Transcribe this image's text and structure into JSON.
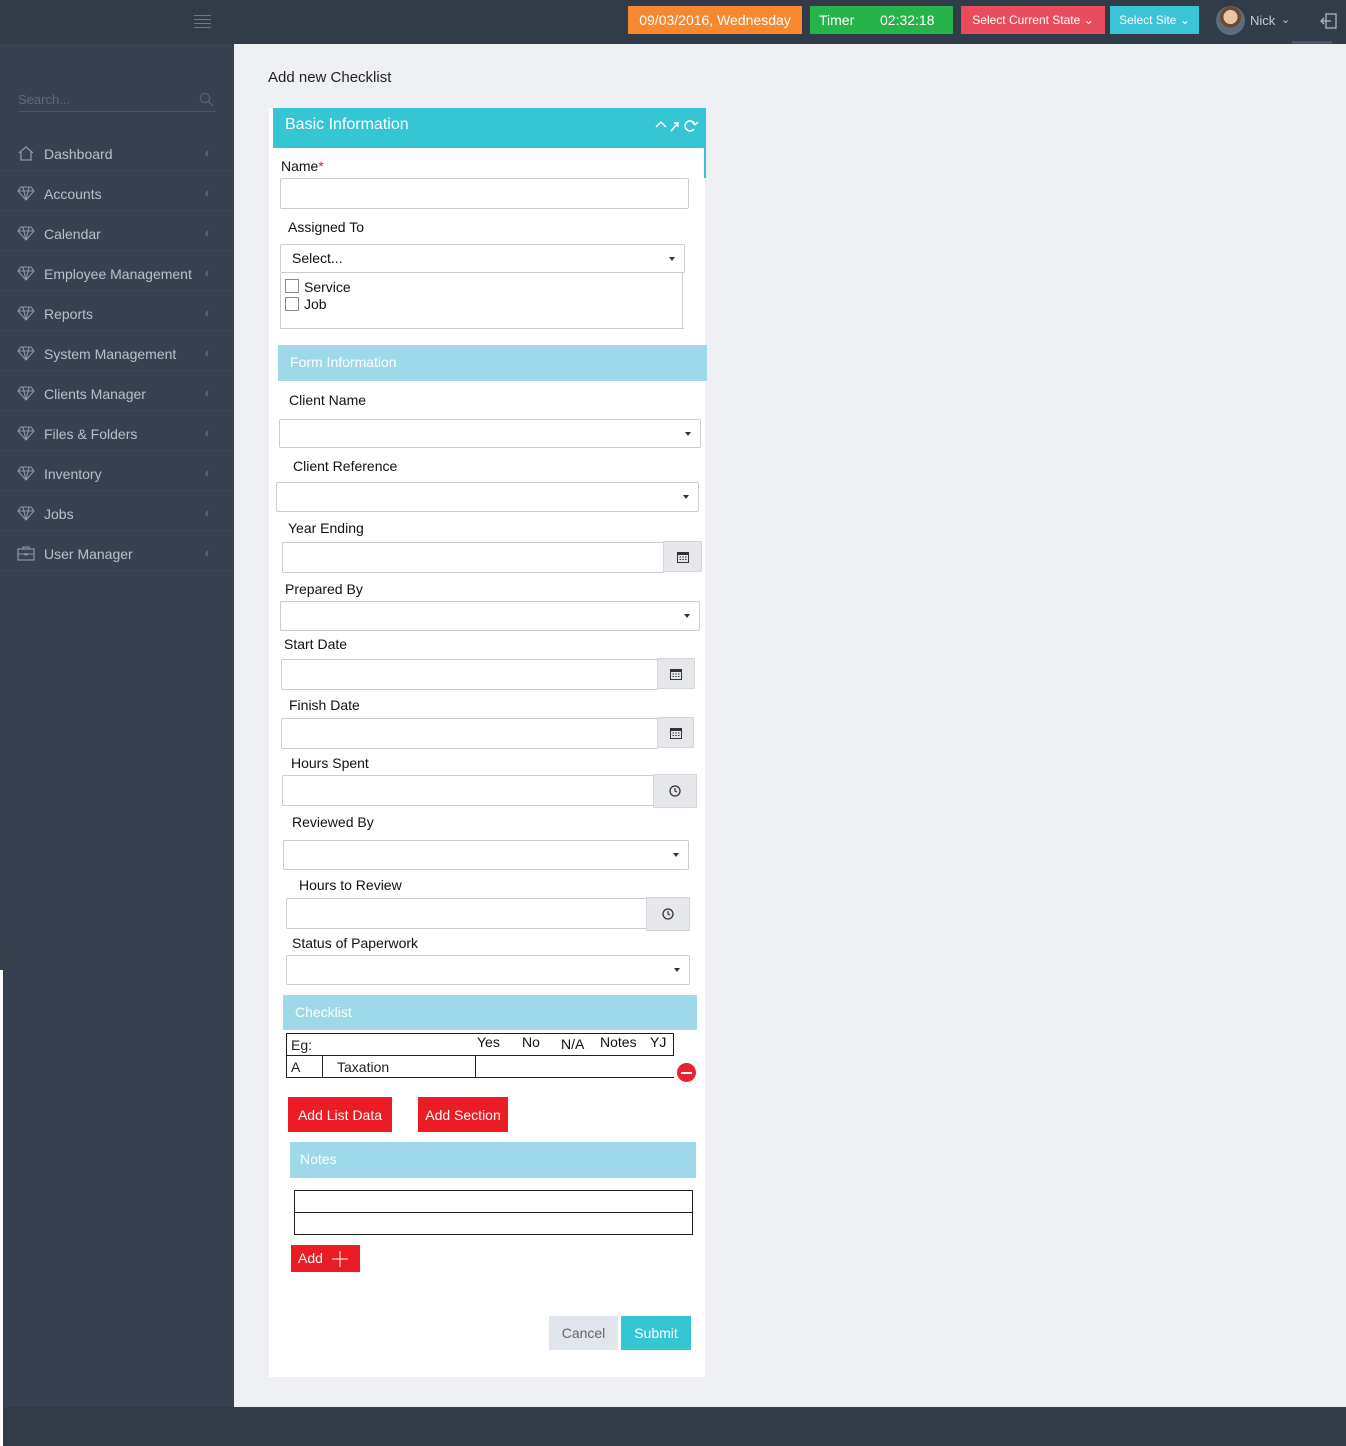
{
  "topbar": {
    "date": "09/03/2016, Wednesday",
    "timer_label": "Timer",
    "timer_value": "02:32:18",
    "select_state": "Select Current State",
    "select_site": "Select Site",
    "user_name": "Nick"
  },
  "sidebar": {
    "search_placeholder": "Search...",
    "items": [
      {
        "label": "Dashboard",
        "icon": "home-icon"
      },
      {
        "label": "Accounts",
        "icon": "diamond-icon"
      },
      {
        "label": "Calendar",
        "icon": "diamond-icon"
      },
      {
        "label": "Employee Management",
        "icon": "diamond-icon"
      },
      {
        "label": "Reports",
        "icon": "diamond-icon"
      },
      {
        "label": "System Management",
        "icon": "diamond-icon"
      },
      {
        "label": "Clients Manager",
        "icon": "diamond-icon"
      },
      {
        "label": "Files & Folders",
        "icon": "diamond-icon"
      },
      {
        "label": "Inventory",
        "icon": "diamond-icon"
      },
      {
        "label": "Jobs",
        "icon": "diamond-icon"
      },
      {
        "label": "User Manager",
        "icon": "briefcase-icon"
      }
    ]
  },
  "page": {
    "title": "Add new Checklist"
  },
  "basic": {
    "header": "Basic Information",
    "name_label": "Name",
    "name_required": "*",
    "name_value": "",
    "assigned_label": "Assigned To",
    "assigned_select": "Select...",
    "assigned_options": [
      "Service",
      "Job"
    ]
  },
  "form_info": {
    "header": "Form Information",
    "client_name": "Client Name",
    "client_reference": "Client Reference",
    "year_ending": "Year Ending",
    "prepared_by": "Prepared By",
    "start_date": "Start Date",
    "finish_date": "Finish Date",
    "hours_spent": "Hours Spent",
    "reviewed_by": "Reviewed By",
    "hours_to_review": "Hours to Review",
    "status_of_paperwork": "Status of Paperwork"
  },
  "checklist": {
    "header": "Checklist",
    "example_label": "Eg:",
    "columns": [
      "Yes",
      "No",
      "N/A",
      "Notes",
      "YJ"
    ],
    "rows": [
      {
        "code": "A",
        "item": "Taxation"
      }
    ],
    "add_list_data": "Add List Data",
    "add_section": "Add Section"
  },
  "notes": {
    "header": "Notes",
    "add": "Add"
  },
  "actions": {
    "cancel": "Cancel",
    "submit": "Submit"
  },
  "colors": {
    "topbar": "#323b48",
    "sidebar": "#38414f",
    "date_badge": "#f7882f",
    "timer_badge": "#26b34a",
    "state_button": "#e84c5d",
    "site_button": "#3bc4d6",
    "primary": "#36c6d3",
    "section_light": "#9dd9e8",
    "danger": "#ec1c24"
  }
}
